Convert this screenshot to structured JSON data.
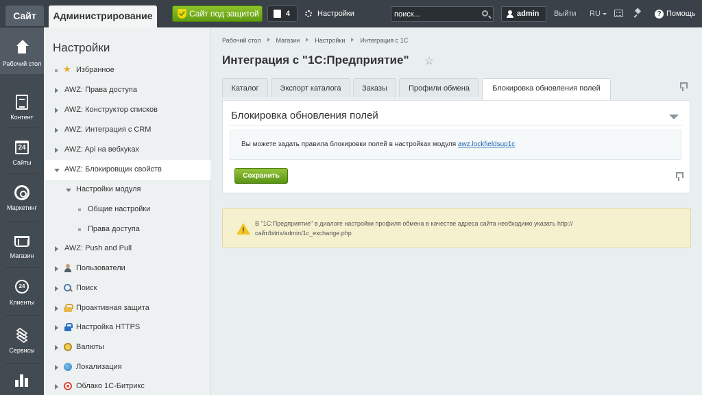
{
  "topbar": {
    "site_tab": "Сайт",
    "admin_tab": "Администрирование",
    "protected_label": "Сайт под защитой",
    "notifications_count": "4",
    "settings_label": "Настройки",
    "search_placeholder": "поиск...",
    "user_name": "admin",
    "logout_label": "Выйти",
    "language": "RU",
    "help_label": "Помощь"
  },
  "rail": {
    "items": [
      {
        "label": "Рабочий стол",
        "icon": "home-icon"
      },
      {
        "label": "Контент",
        "icon": "document-icon"
      },
      {
        "label": "Сайты",
        "icon": "calendar-icon",
        "badge": "24"
      },
      {
        "label": "Маркетинг",
        "icon": "target-icon"
      },
      {
        "label": "Магазин",
        "icon": "cart-icon"
      },
      {
        "label": "Клиенты",
        "icon": "clients-icon",
        "badge": "24"
      },
      {
        "label": "Сервисы",
        "icon": "layers-icon"
      },
      {
        "label": "",
        "icon": "analytics-icon"
      }
    ]
  },
  "tree": {
    "title": "Настройки",
    "items": [
      {
        "label": "Избранное",
        "icon": "star-icon"
      },
      {
        "label": "AWZ: Права доступа"
      },
      {
        "label": "AWZ: Конструктор списков"
      },
      {
        "label": "AWZ: Интеграция с CRM"
      },
      {
        "label": "AWZ: Api на вебхуках"
      },
      {
        "label": "AWZ: Блокировщик свойств",
        "active": true
      },
      {
        "label": "Настройки модуля"
      },
      {
        "label": "Общие настройки"
      },
      {
        "label": "Права доступа"
      },
      {
        "label": "AWZ: Push and Pull"
      },
      {
        "label": "Пользователи",
        "icon": "user-icon"
      },
      {
        "label": "Поиск",
        "icon": "search-icon"
      },
      {
        "label": "Проактивная защита",
        "icon": "lock-icon"
      },
      {
        "label": "Настройка HTTPS",
        "icon": "https-lock-icon"
      },
      {
        "label": "Валюты",
        "icon": "coin-icon"
      },
      {
        "label": "Локализация",
        "icon": "globe-icon"
      },
      {
        "label": "Облако 1С-Битрикс",
        "icon": "cloud-icon"
      }
    ]
  },
  "breadcrumbs": [
    "Рабочий стол",
    "Магазин",
    "Настройки",
    "Интеграция с 1С"
  ],
  "page": {
    "title": "Интеграция с \"1С:Предприятие\""
  },
  "tabs": [
    {
      "label": "Каталог"
    },
    {
      "label": "Экспорт каталога"
    },
    {
      "label": "Заказы"
    },
    {
      "label": "Профили обмена"
    },
    {
      "label": "Блокировка обновления полей",
      "active": true
    }
  ],
  "panel": {
    "title": "Блокировка обновления полей",
    "info_text": "Вы можете задать правила блокировки полей в настройках модуля",
    "info_link": "awz.lockfieldsup1c",
    "save_button": "Сохранить"
  },
  "warning": {
    "line1": "В \"1С:Предприятие\" в диалоге настройки профиля обмена в качестве адреса сайта необходимо указать http://",
    "line2": "сайт/bitrix/admin/1c_exchange.php"
  }
}
